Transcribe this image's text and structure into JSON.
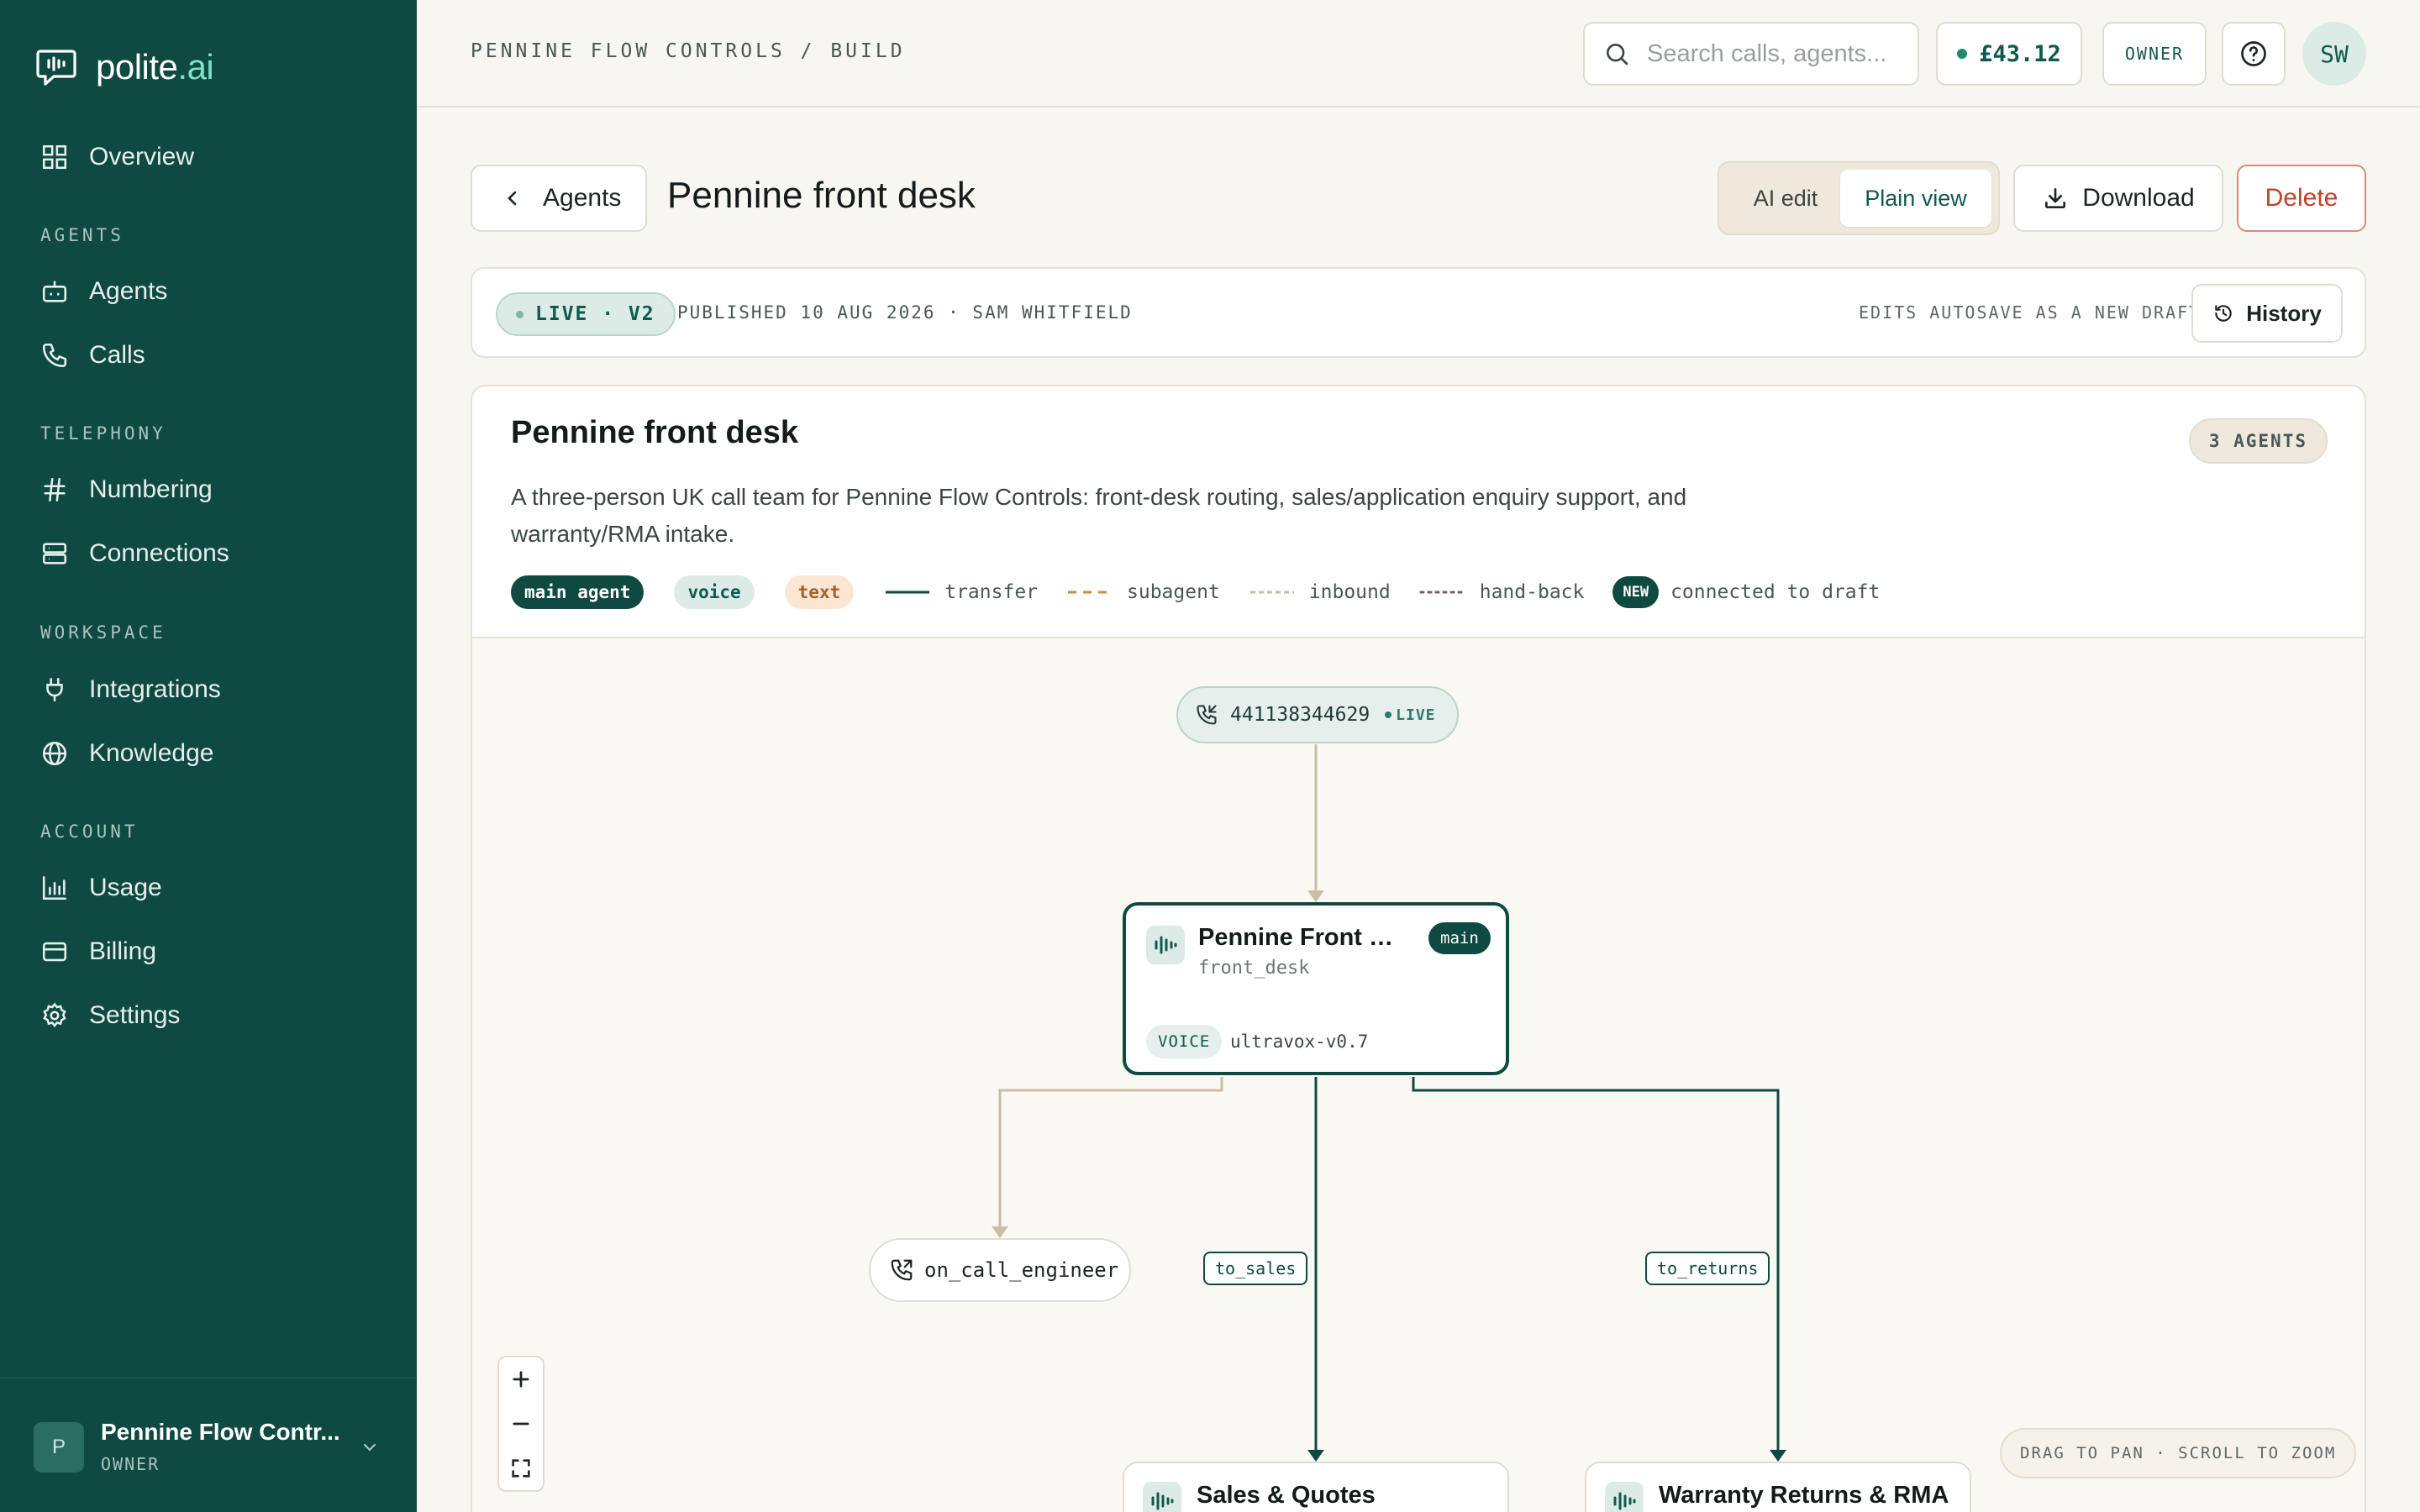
{
  "brand": {
    "name_prefix": "polite",
    "name_suffix": ".ai",
    "logo_icon": "chat-bubble-waveform-icon"
  },
  "sidebar": {
    "overview": {
      "label": "Overview",
      "icon": "grid-icon"
    },
    "sections": {
      "agents": "AGENTS",
      "telephony": "TELEPHONY",
      "workspace": "WORKSPACE",
      "account": "ACCOUNT"
    },
    "items": {
      "agents": {
        "label": "Agents",
        "icon": "robot-icon"
      },
      "calls": {
        "label": "Calls",
        "icon": "phone-icon"
      },
      "numbering": {
        "label": "Numbering",
        "icon": "hash-icon"
      },
      "connections": {
        "label": "Connections",
        "icon": "server-icon"
      },
      "integrations": {
        "label": "Integrations",
        "icon": "plug-icon"
      },
      "knowledge": {
        "label": "Knowledge",
        "icon": "globe-icon"
      },
      "usage": {
        "label": "Usage",
        "icon": "bar-chart-icon"
      },
      "billing": {
        "label": "Billing",
        "icon": "credit-card-icon"
      },
      "settings": {
        "label": "Settings",
        "icon": "gear-icon"
      }
    },
    "org": {
      "initial": "P",
      "name": "Pennine Flow Contr...",
      "role": "OWNER"
    }
  },
  "topbar": {
    "breadcrumb": "PENNINE FLOW CONTROLS / BUILD",
    "search_placeholder": "Search calls, agents...",
    "balance": "£43.12",
    "role": "OWNER",
    "user_initials": "SW"
  },
  "header": {
    "back_label": "Agents",
    "title": "Pennine front desk",
    "mode_ai": "AI edit",
    "mode_plain": "Plain view",
    "mode_selected": "Plain view",
    "download_label": "Download",
    "delete_label": "Delete"
  },
  "status": {
    "live_label": "LIVE · V2",
    "published": "PUBLISHED 10 AUG 2026 · SAM WHITFIELD",
    "autosave": "EDITS AUTOSAVE AS A NEW DRAFT",
    "history_label": "History"
  },
  "team": {
    "title": "Pennine front desk",
    "agent_count": "3 AGENTS",
    "description": "A three-person UK call team for Pennine Flow Controls: front-desk routing, sales/application enquiry support, and warranty/RMA intake.",
    "legend": {
      "main_agent": "main agent",
      "voice": "voice",
      "text": "text",
      "transfer": "transfer",
      "subagent": "subagent",
      "inbound": "inbound",
      "hand_back": "hand-back",
      "new_badge": "NEW",
      "new_label": "connected to draft"
    }
  },
  "graph": {
    "phone": {
      "number": "441138344629",
      "status": "LIVE"
    },
    "main_agent": {
      "name": "Pennine Front De...",
      "slug": "front_desk",
      "badge": "main",
      "channel": "VOICE",
      "model": "ultravox-v0.7"
    },
    "escalation": {
      "label": "on_call_engineer"
    },
    "edges": {
      "to_sales": "to_sales",
      "to_returns": "to_returns"
    },
    "subagents": {
      "sales": "Sales & Quotes",
      "returns": "Warranty Returns & RMA"
    },
    "hint": "DRAG TO PAN · SCROLL TO ZOOM"
  },
  "colors": {
    "sidebar_bg": "#0f4a42",
    "accent": "#0f5a4f",
    "page_bg": "#f8f6f1",
    "danger": "#c2412b",
    "inbound_edge": "#c9bda6"
  }
}
